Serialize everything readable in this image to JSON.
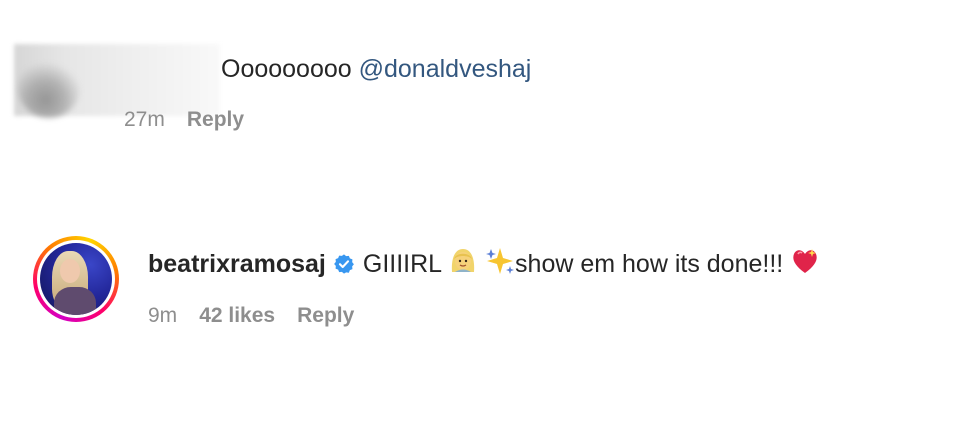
{
  "comments": [
    {
      "username_hidden": true,
      "text_prefix": "Ooooooooo ",
      "mention": "@donaldveshaj",
      "time": "27m",
      "reply_label": "Reply"
    },
    {
      "username": "beatrixramosaj",
      "verified": true,
      "text_parts": [
        "GIIIIRL ",
        " ",
        "show em how its done!!! "
      ],
      "emojis": [
        "woman-blond-hair-icon",
        "sparkles-icon",
        "sparkling-heart-icon"
      ],
      "time": "9m",
      "likes": "42 likes",
      "reply_label": "Reply"
    }
  ],
  "colors": {
    "mention": "#33577f",
    "meta": "#8e8e8e",
    "verified": "#3897f0",
    "text": "#262626"
  }
}
